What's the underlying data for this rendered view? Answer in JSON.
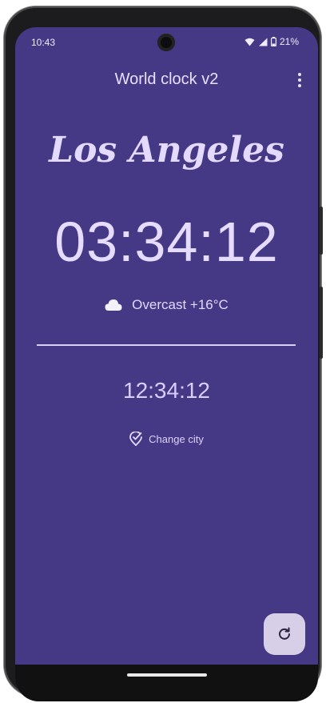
{
  "status_bar": {
    "time": "10:43",
    "battery_percent": "21%",
    "icons": [
      "wifi-icon",
      "cellular-signal-icon",
      "battery-icon"
    ]
  },
  "app_bar": {
    "title": "World clock v2",
    "menu_icon": "more-vert-icon"
  },
  "main": {
    "city_name": "Los Angeles",
    "city_time": "03:34:12",
    "weather": {
      "icon": "cloud-icon",
      "text": "Overcast +16°C"
    },
    "local_time": "12:34:12",
    "change_city": {
      "icon": "location-check-icon",
      "label": "Change city"
    }
  },
  "fab": {
    "icon": "refresh-icon"
  },
  "colors": {
    "background": "#453885",
    "text": "#e6dcff",
    "fab": "#d7cfe8"
  }
}
